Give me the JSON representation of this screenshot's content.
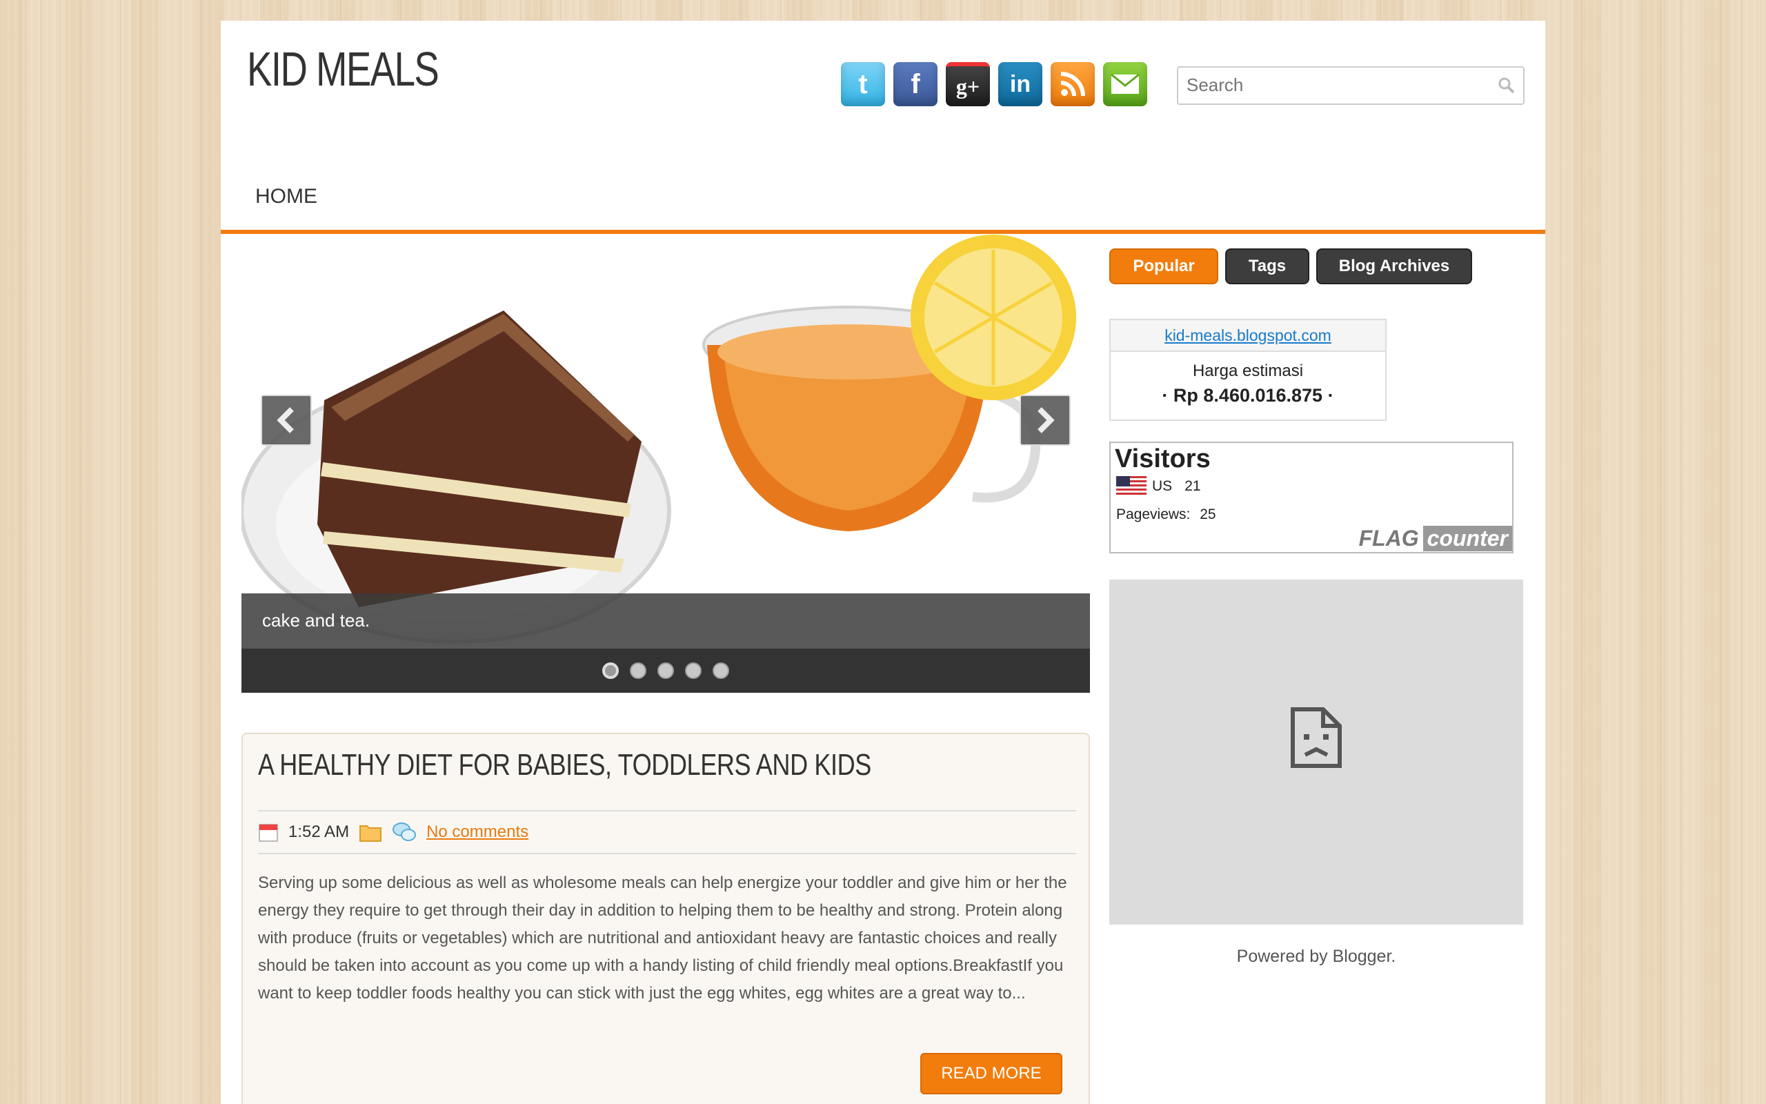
{
  "site": {
    "title": "KID MEALS"
  },
  "social": [
    {
      "icon": "twitter-icon",
      "glyph": "t"
    },
    {
      "icon": "facebook-icon",
      "glyph": "f"
    },
    {
      "icon": "google-plus-icon",
      "glyph": "g+"
    },
    {
      "icon": "linkedin-icon",
      "glyph": "in"
    },
    {
      "icon": "rss-icon",
      "glyph": ""
    },
    {
      "icon": "email-icon",
      "glyph": ""
    }
  ],
  "search": {
    "placeholder": "Search"
  },
  "nav": {
    "home": "HOME"
  },
  "slider": {
    "caption": "cake and tea.",
    "dot_count": 5,
    "active_index": 0
  },
  "post": {
    "title": "A HEALTHY DIET FOR BABIES, TODDLERS AND KIDS",
    "time": "1:52 AM",
    "comments": "No comments",
    "body": "Serving up some delicious as well as wholesome meals can help energize your toddler and give him or her the energy they require to get through their day in addition to helping them to be healthy and strong. Protein along with produce (fruits or vegetables) which are nutritional and antioxidant heavy are fantastic choices and really should be taken into account as you come up with a handy listing of child friendly meal options.BreakfastIf you want to keep toddler foods healthy you can stick with just the egg whites, egg whites are a great way to...",
    "read_more": "READ MORE"
  },
  "sidebar": {
    "tabs": {
      "popular": "Popular",
      "tags": "Tags",
      "archives": "Blog Archives"
    },
    "estimate": {
      "link": "kid-meals.blogspot.com",
      "label": "Harga estimasi",
      "price": "· Rp 8.460.016.875 ·"
    },
    "flag_counter": {
      "heading": "Visitors",
      "country": "US",
      "country_count": "21",
      "pageviews_label": "Pageviews:",
      "pageviews": "25",
      "brand_flag": "FLAG",
      "brand_counter": "counter"
    },
    "powered_by": "Powered by Blogger."
  },
  "colors": {
    "accent": "#f27d0c",
    "dark_tab": "#3d3d3d",
    "link": "#1a7ac8"
  }
}
